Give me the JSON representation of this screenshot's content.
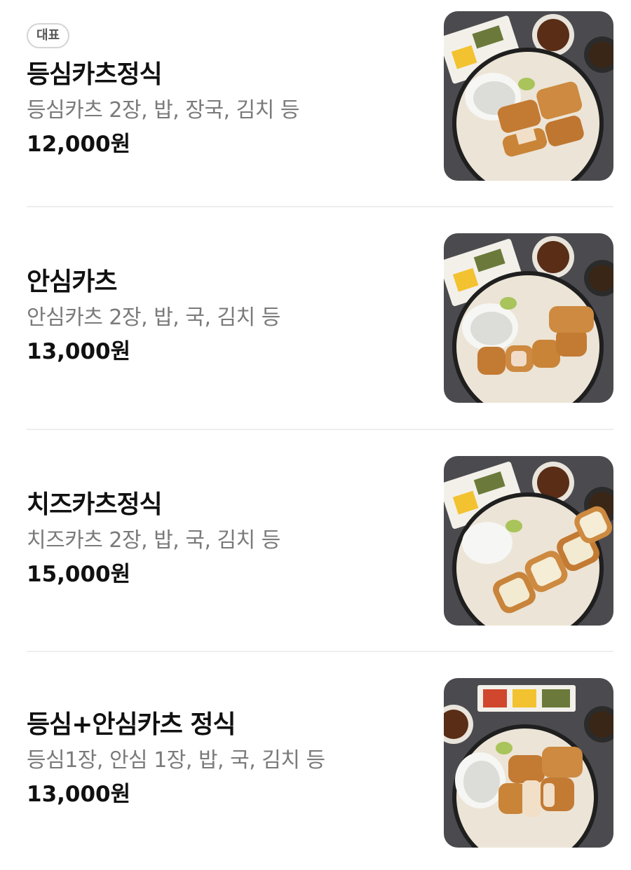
{
  "menu": {
    "items": [
      {
        "badge": "대표",
        "name": "등심카츠정식",
        "description": "등심카츠 2장, 밥, 장국, 김치 등",
        "price": "12,000원",
        "photo": "pork-loin-katsu-set-photo"
      },
      {
        "name": "안심카츠",
        "description": "안심카츠 2장, 밥, 국, 김치 등",
        "price": "13,000원",
        "photo": "pork-tenderloin-katsu-photo"
      },
      {
        "name": "치즈카츠정식",
        "description": "치즈카츠 2장, 밥, 국, 김치 등",
        "price": "15,000원",
        "photo": "cheese-katsu-set-photo"
      },
      {
        "name": "등심+안심카츠 정식",
        "description": "등심1장, 안심 1장, 밥, 국, 김치 등",
        "price": "13,000원",
        "photo": "loin-tenderloin-katsu-set-photo"
      }
    ]
  },
  "colors": {
    "text_primary": "#111111",
    "text_secondary": "#7a7a7a",
    "divider": "#eeeeee",
    "photo_background": "#4a4a4e",
    "katsu": "#c9833b"
  }
}
